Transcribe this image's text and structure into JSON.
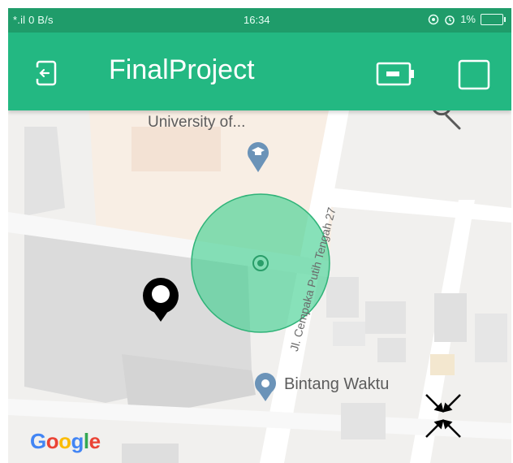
{
  "statusbar": {
    "network": "*.il",
    "speed": "0 B/s",
    "time": "16:34",
    "battery": "1%"
  },
  "appbar": {
    "title": "FinalProject",
    "color": "#23b882",
    "icons": [
      "exit-door-icon",
      "battery-toggle-icon",
      "square-icon"
    ]
  },
  "map": {
    "poi_university": "University of...",
    "poi_bintang": "Bintang Waktu",
    "street": "Jl. Cempaka Putih Tengah 27",
    "google_letters": [
      "G",
      "o",
      "o",
      "g",
      "l",
      "e"
    ],
    "accent_circle": "#3ecf8e"
  }
}
